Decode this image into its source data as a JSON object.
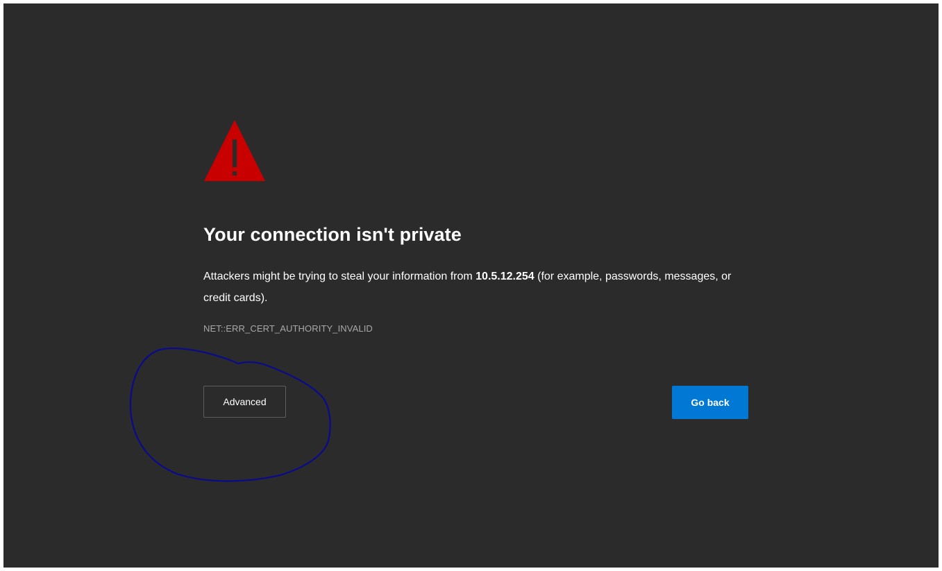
{
  "page": {
    "icon": "warning-triangle-icon",
    "title": "Your connection isn't private",
    "message_prefix": "Attackers might be trying to steal your information from ",
    "host": "10.5.12.254",
    "message_suffix": " (for example, passwords, messages, or credit cards).",
    "error_code": "NET::ERR_CERT_AUTHORITY_INVALID"
  },
  "buttons": {
    "advanced_label": "Advanced",
    "go_back_label": "Go back"
  },
  "colors": {
    "background": "#2b2b2b",
    "warning_red": "#c80000",
    "primary_button": "#0078d4",
    "annotation_ink": "#0a0a8c"
  }
}
